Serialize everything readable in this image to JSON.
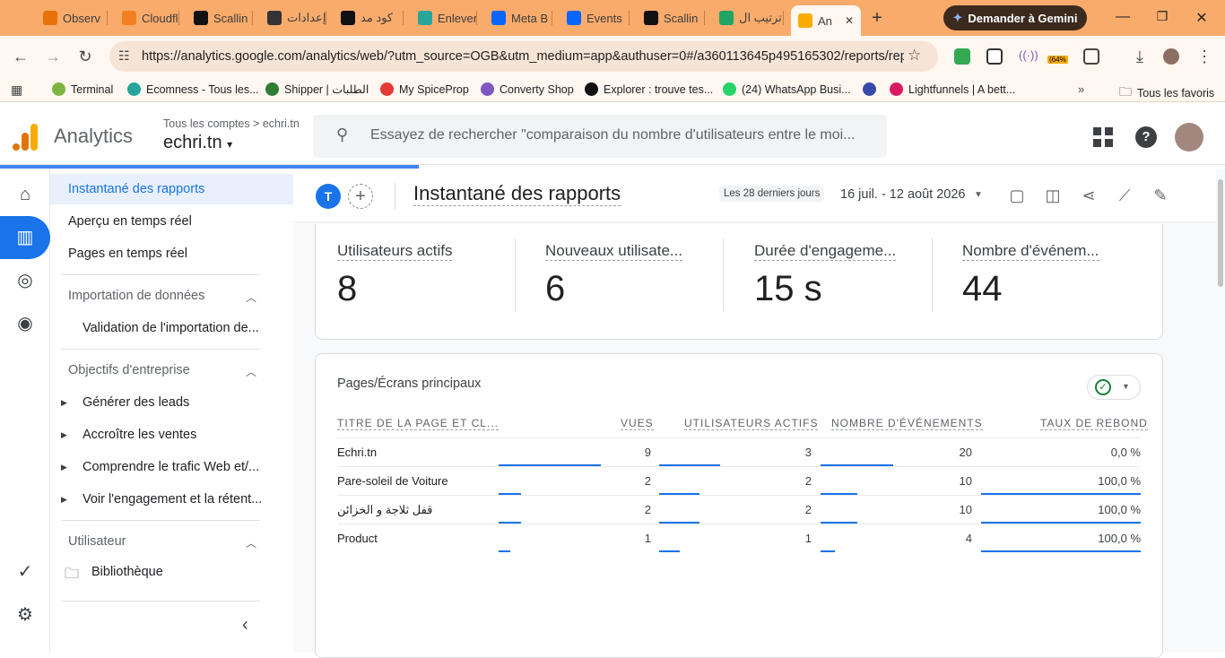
{
  "browser": {
    "tabs": [
      {
        "label": "Observ",
        "icon": "orange-dot-icon",
        "color": "#e8710a"
      },
      {
        "label": "Cloudfl",
        "icon": "cloudflare-icon",
        "color": "#f38020"
      },
      {
        "label": "Scallin",
        "icon": "scalling-icon",
        "color": "#111111"
      },
      {
        "label": "إعدادات",
        "icon": "chatgpt-icon",
        "color": "#333333"
      },
      {
        "label": "كود مد",
        "icon": "k-icon",
        "color": "#111111"
      },
      {
        "label": "Enlever",
        "icon": "enlever-icon",
        "color": "#2aa59a"
      },
      {
        "label": "Meta B",
        "icon": "meta-icon",
        "color": "#0866ff"
      },
      {
        "label": "Events",
        "icon": "meta-icon",
        "color": "#0866ff"
      },
      {
        "label": "Scallin",
        "icon": "scalling-icon",
        "color": "#111111"
      },
      {
        "label": "ترتيب ال",
        "icon": "sheets-icon",
        "color": "#1fa463"
      },
      {
        "label": "An",
        "icon": "analytics-icon",
        "color": "#f9ab00",
        "active": true
      }
    ],
    "gemini_label": "Demander à Gemini",
    "url": "https://analytics.google.com/analytics/web/?utm_source=OGB&utm_medium=app&authuser=0#/a360113645p495165302/reports/rep...",
    "extension_badge": "(64%",
    "bookmarks": [
      {
        "label": "Terminal",
        "color": "#7cb342"
      },
      {
        "label": "Ecomness - Tous les...",
        "color": "#26a69a"
      },
      {
        "label": "Shipper | الطلبات",
        "color": "#2e7d32"
      },
      {
        "label": "My SpiceProp",
        "color": "#e53935"
      },
      {
        "label": "Converty Shop",
        "color": "#7e57c2"
      },
      {
        "label": "Explorer : trouve tes...",
        "color": "#111111"
      },
      {
        "label": "(24) WhatsApp Busi...",
        "color": "#25d366"
      },
      {
        "label": "",
        "color": "#3949ab"
      },
      {
        "label": "Lightfunnels | A bett...",
        "color": "#d81b60"
      }
    ],
    "bookmarks_all": "Tous les favoris"
  },
  "app": {
    "name": "Analytics",
    "breadcrumb": "Tous les comptes > echri.tn",
    "property": "echri.tn",
    "search_placeholder": "Essayez de rechercher \"comparaison du nombre d'utilisateurs entre le moi..."
  },
  "nav": {
    "items": [
      "Instantané des rapports",
      "Aperçu en temps réel",
      "Pages en temps réel"
    ],
    "section_import": "Importation de données",
    "import_item": "Validation de l'importation de...",
    "section_objectives": "Objectifs d'entreprise",
    "objectives": [
      "Générer des leads",
      "Accroître les ventes",
      "Comprendre le trafic Web et/...",
      "Voir l'engagement et la rétent..."
    ],
    "section_user": "Utilisateur",
    "library": "Bibliothèque"
  },
  "report": {
    "avatar_letter": "T",
    "title": "Instantané des rapports",
    "date_label": "Les 28 derniers jours",
    "date_range": "16 juil. - 12 août 2026"
  },
  "metrics": [
    {
      "name": "Utilisateurs actifs",
      "value": "8"
    },
    {
      "name": "Nouveaux utilisate...",
      "value": "6"
    },
    {
      "name": "Durée d'engageme...",
      "value": "15 s"
    },
    {
      "name": "Nombre d'événem...",
      "value": "44"
    }
  ],
  "table": {
    "title": "Pages/Écrans principaux",
    "headers": [
      "TITRE DE LA PAGE ET CL...",
      "VUES",
      "UTILISATEURS ACTIFS",
      "NOMBRE D'ÉVÉNEMENTS",
      "TAUX DE REBOND"
    ],
    "rows": [
      {
        "title": "Echri.tn",
        "views": "9",
        "users": "3",
        "events": "20",
        "bounce": "0,0 %",
        "views_frac": 1.0,
        "users_frac": 1.0,
        "events_frac": 1.0,
        "bounce_frac": 0.0
      },
      {
        "title": "Pare-soleil de Voiture",
        "views": "2",
        "users": "2",
        "events": "10",
        "bounce": "100,0 %",
        "views_frac": 0.222,
        "users_frac": 0.667,
        "events_frac": 0.5,
        "bounce_frac": 1.0
      },
      {
        "title": "قفل ثلاجة و الخزائن",
        "views": "2",
        "users": "2",
        "events": "10",
        "bounce": "100,0 %",
        "views_frac": 0.222,
        "users_frac": 0.667,
        "events_frac": 0.5,
        "bounce_frac": 1.0
      },
      {
        "title": "Product",
        "views": "1",
        "users": "1",
        "events": "4",
        "bounce": "100,0 %",
        "views_frac": 0.111,
        "users_frac": 0.333,
        "events_frac": 0.2,
        "bounce_frac": 1.0
      }
    ]
  },
  "colors": {
    "accent": "#1a73e8",
    "tabstrip": "#f9ab6c",
    "toolbar": "#fff7f0"
  }
}
